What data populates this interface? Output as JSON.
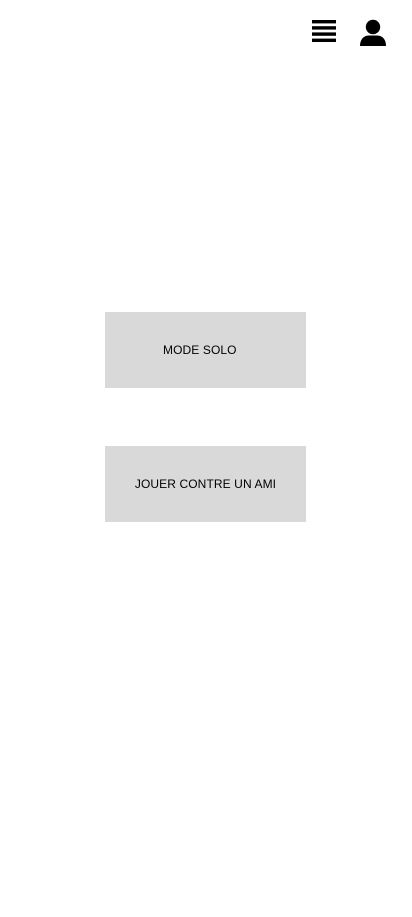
{
  "header": {
    "menu_icon": "list-menu-icon",
    "profile_icon": "user-icon"
  },
  "main": {
    "solo_label": "MODE SOLO",
    "friend_label": "JOUER CONTRE UN AMI"
  },
  "colors": {
    "background": "#ffffff",
    "button_bg": "#d9d9d9",
    "icon": "#000000"
  }
}
